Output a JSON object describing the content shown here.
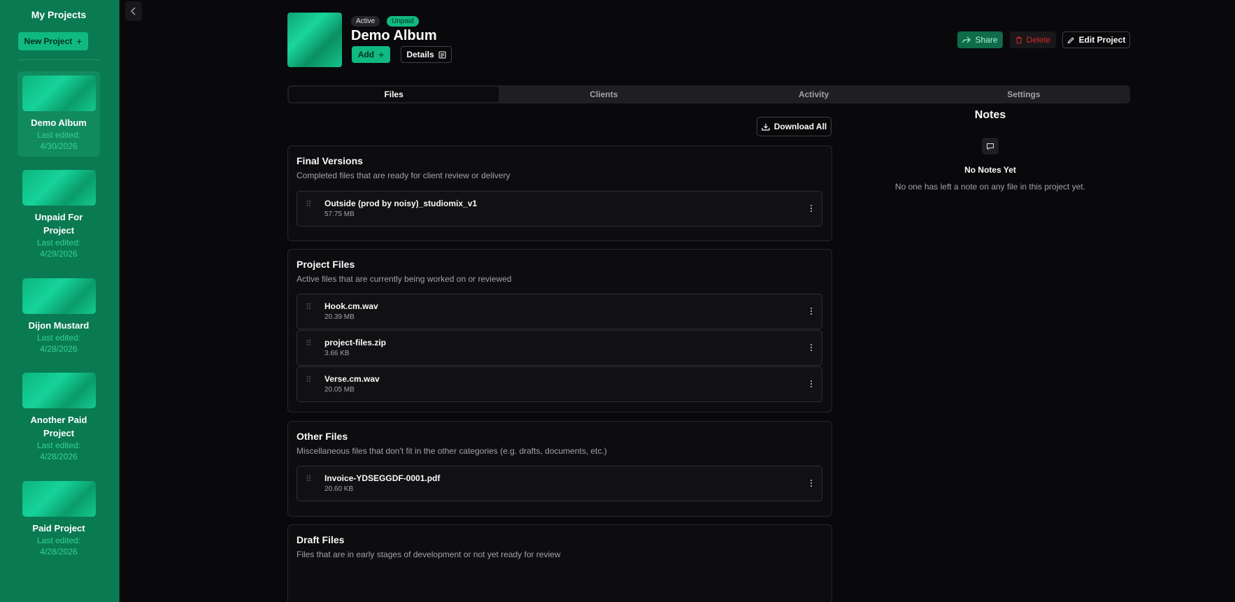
{
  "sidebar": {
    "title": "My Projects",
    "new_project_label": "New Project",
    "projects": [
      {
        "name": "Demo Album",
        "edited_label": "Last edited:",
        "edited_date": "4/30/2026",
        "active": true
      },
      {
        "name": "Unpaid For Project",
        "edited_label": "Last edited:",
        "edited_date": "4/29/2026",
        "active": false
      },
      {
        "name": "Dijon Mustard",
        "edited_label": "Last edited:",
        "edited_date": "4/28/2026",
        "active": false
      },
      {
        "name": "Another Paid Project",
        "edited_label": "Last edited:",
        "edited_date": "4/28/2026",
        "active": false
      },
      {
        "name": "Paid Project",
        "edited_label": "Last edited:",
        "edited_date": "4/28/2026",
        "active": false
      }
    ]
  },
  "header": {
    "status_badge": "Active",
    "payment_badge": "Unpaid",
    "title": "Demo Album",
    "add_label": "Add",
    "details_label": "Details",
    "share_label": "Share",
    "delete_label": "Delete",
    "edit_label": "Edit Project"
  },
  "tabs": [
    {
      "label": "Files",
      "active": true
    },
    {
      "label": "Clients",
      "active": false
    },
    {
      "label": "Activity",
      "active": false
    },
    {
      "label": "Settings",
      "active": false
    }
  ],
  "download_all_label": "Download All",
  "sections": [
    {
      "title": "Final Versions",
      "description": "Completed files that are ready for client review or delivery",
      "files": [
        {
          "name": "Outside (prod by noisy)_studiomix_v1",
          "size": "57.75 MB"
        }
      ]
    },
    {
      "title": "Project Files",
      "description": "Active files that are currently being worked on or reviewed",
      "files": [
        {
          "name": "Hook.cm.wav",
          "size": "20.39 MB"
        },
        {
          "name": "project-files.zip",
          "size": "3.66 KB"
        },
        {
          "name": "Verse.cm.wav",
          "size": "20.05 MB"
        }
      ]
    },
    {
      "title": "Other Files",
      "description": "Miscellaneous files that don't fit in the other categories (e.g. drafts, documents, etc.)",
      "files": [
        {
          "name": "Invoice-YDSEGGDF-0001.pdf",
          "size": "20.60 KB"
        }
      ]
    },
    {
      "title": "Draft Files",
      "description": "Files that are in early stages of development or not yet ready for review",
      "files": []
    }
  ],
  "notes": {
    "title": "Notes",
    "empty_title": "No Notes Yet",
    "empty_description": "No one has left a note on any file in this project yet."
  },
  "colors": {
    "accent": "#10b981",
    "sidebar_bg": "#0a7a52",
    "danger": "#dc2626",
    "background": "#09090b"
  }
}
